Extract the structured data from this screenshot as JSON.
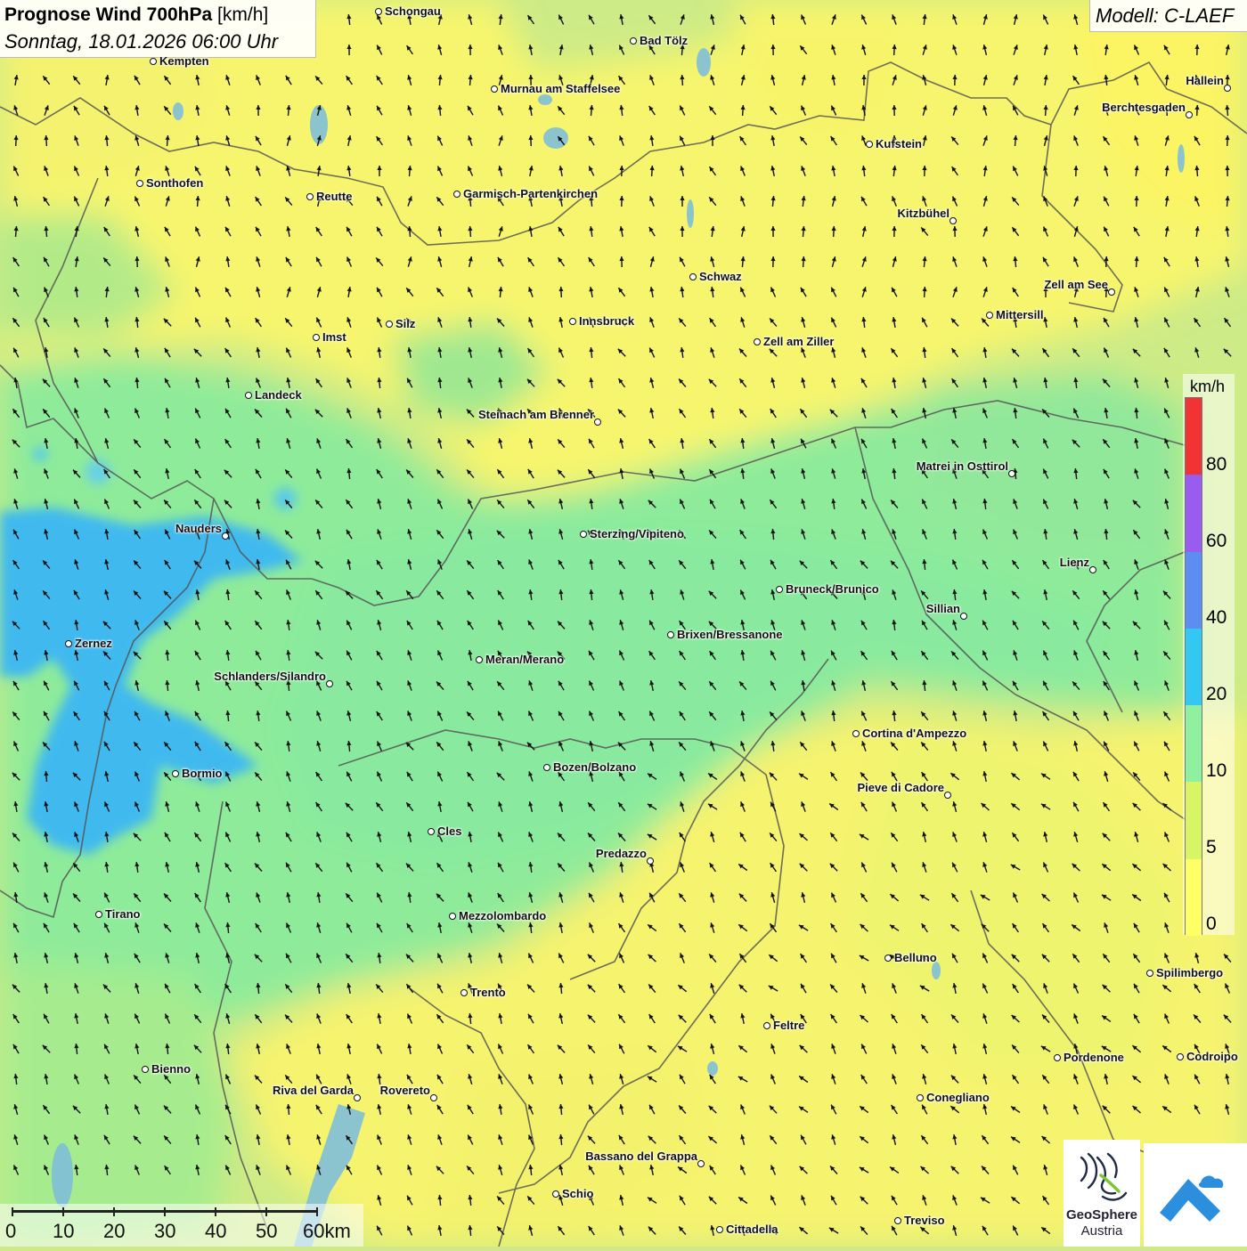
{
  "header": {
    "title_bold": "Prognose Wind 700hPa",
    "title_unit": "[km/h]",
    "datetime": "Sonntag, 18.01.2026 06:00 Uhr",
    "model": "Modell: C-LAEF"
  },
  "legend": {
    "unit": "km/h",
    "ticks": [
      "0",
      "5",
      "10",
      "20",
      "40",
      "60",
      "80"
    ],
    "colors": [
      "#ffff66",
      "#d7f564",
      "#8ff0a0",
      "#33c8f2",
      "#5b8ef0",
      "#9a5bef",
      "#f23333"
    ]
  },
  "scalebar": {
    "labels": [
      "0",
      "10",
      "20",
      "30",
      "40",
      "50",
      "60km"
    ]
  },
  "logos": {
    "geosphere_line1": "GeoSphere",
    "geosphere_line2": "Austria"
  },
  "cities": [
    {
      "name": "Schongau",
      "label_side": "right"
    },
    {
      "name": "Bad Tölz",
      "label_side": "right"
    },
    {
      "name": "Kempten",
      "label_side": "right"
    },
    {
      "name": "Murnau am Staffelsee",
      "label_side": "right"
    },
    {
      "name": "Hallein",
      "label_side": "left"
    },
    {
      "name": "Berchtesgaden",
      "label_side": "left"
    },
    {
      "name": "Kufstein",
      "label_side": "right"
    },
    {
      "name": "Sonthofen",
      "label_side": "right"
    },
    {
      "name": "Reutte",
      "label_side": "right"
    },
    {
      "name": "Garmisch-Partenkirchen",
      "label_side": "right"
    },
    {
      "name": "Kitzbühel",
      "label_side": "left"
    },
    {
      "name": "Schwaz",
      "label_side": "right"
    },
    {
      "name": "Zell am See",
      "label_side": "left"
    },
    {
      "name": "Mittersill",
      "label_side": "right"
    },
    {
      "name": "Innsbruck",
      "label_side": "right"
    },
    {
      "name": "Silz",
      "label_side": "right"
    },
    {
      "name": "Imst",
      "label_side": "right"
    },
    {
      "name": "Zell am Ziller",
      "label_side": "right"
    },
    {
      "name": "Landeck",
      "label_side": "right"
    },
    {
      "name": "Steinach am Brenner",
      "label_side": "left"
    },
    {
      "name": "Matrei in Osttirol",
      "label_side": "left"
    },
    {
      "name": "Nauders",
      "label_side": "left"
    },
    {
      "name": "Sterzing/Vipiteno",
      "label_side": "right"
    },
    {
      "name": "Lienz",
      "label_side": "left"
    },
    {
      "name": "Bruneck/Brunico",
      "label_side": "right"
    },
    {
      "name": "Sillian",
      "label_side": "left"
    },
    {
      "name": "Zernez",
      "label_side": "right"
    },
    {
      "name": "Brixen/Bressanone",
      "label_side": "right"
    },
    {
      "name": "Meran/Merano",
      "label_side": "right"
    },
    {
      "name": "Schlanders/Silandro",
      "label_side": "left"
    },
    {
      "name": "Cortina d'Ampezzo",
      "label_side": "right"
    },
    {
      "name": "Bormio",
      "label_side": "right"
    },
    {
      "name": "Bozen/Bolzano",
      "label_side": "right"
    },
    {
      "name": "Pieve di Cadore",
      "label_side": "left"
    },
    {
      "name": "Cles",
      "label_side": "right"
    },
    {
      "name": "Predazzo",
      "label_side": "left"
    },
    {
      "name": "Tirano",
      "label_side": "right"
    },
    {
      "name": "Mezzolombardo",
      "label_side": "right"
    },
    {
      "name": "Belluno",
      "label_side": "right"
    },
    {
      "name": "Spilimbergo",
      "label_side": "right"
    },
    {
      "name": "Trento",
      "label_side": "right"
    },
    {
      "name": "Feltre",
      "label_side": "right"
    },
    {
      "name": "Pordenone",
      "label_side": "right"
    },
    {
      "name": "Codroipo",
      "label_side": "right"
    },
    {
      "name": "Bienno",
      "label_side": "right"
    },
    {
      "name": "Riva del Garda",
      "label_side": "left"
    },
    {
      "name": "Rovereto",
      "label_side": "left"
    },
    {
      "name": "Conegliano",
      "label_side": "right"
    },
    {
      "name": "Bassano del Grappa",
      "label_side": "left"
    },
    {
      "name": "Schio",
      "label_side": "right"
    },
    {
      "name": "Treviso",
      "label_side": "right"
    },
    {
      "name": "Cittadella",
      "label_side": "right"
    }
  ]
}
